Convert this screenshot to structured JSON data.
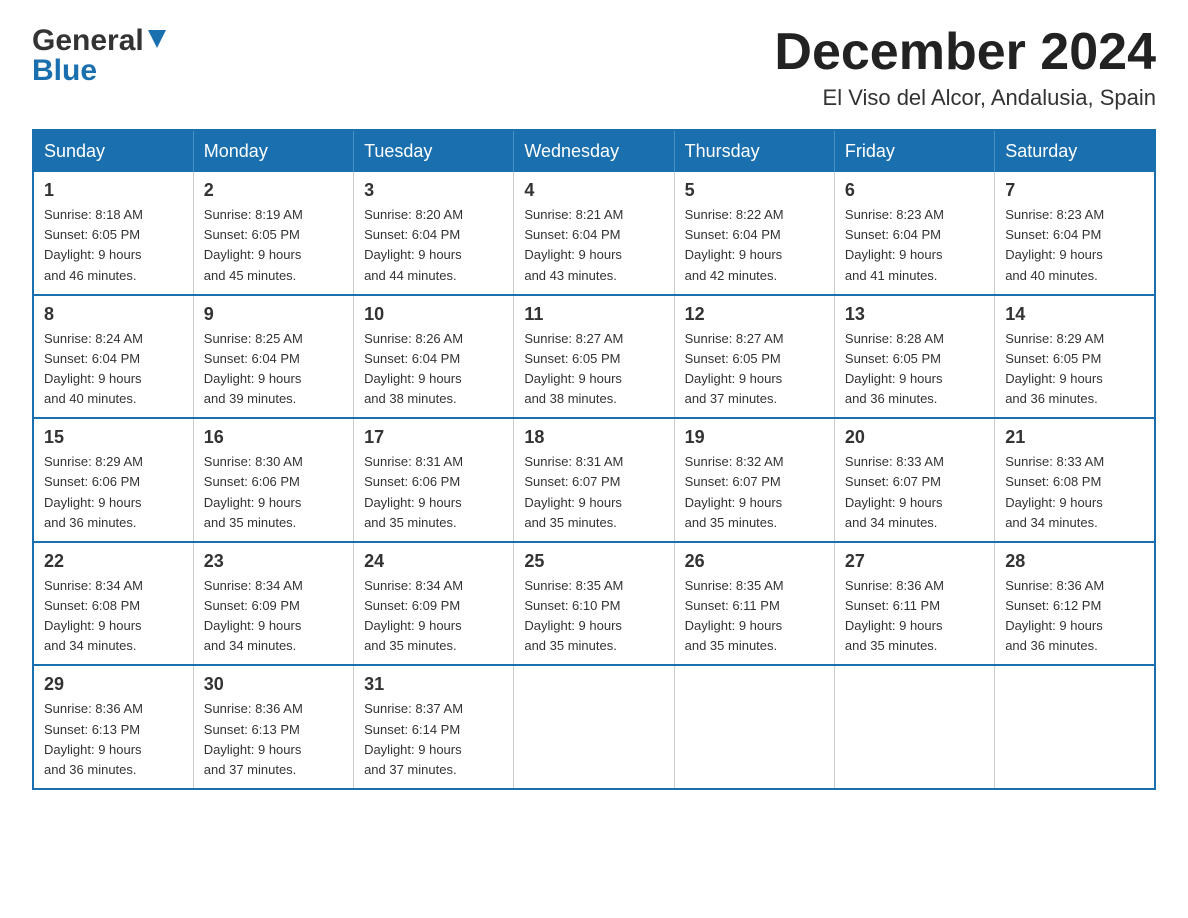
{
  "header": {
    "logo_general": "General",
    "logo_blue": "Blue",
    "month_title": "December 2024",
    "location": "El Viso del Alcor, Andalusia, Spain"
  },
  "days_of_week": [
    "Sunday",
    "Monday",
    "Tuesday",
    "Wednesday",
    "Thursday",
    "Friday",
    "Saturday"
  ],
  "weeks": [
    [
      {
        "day": "1",
        "sunrise": "8:18 AM",
        "sunset": "6:05 PM",
        "daylight": "9 hours and 46 minutes."
      },
      {
        "day": "2",
        "sunrise": "8:19 AM",
        "sunset": "6:05 PM",
        "daylight": "9 hours and 45 minutes."
      },
      {
        "day": "3",
        "sunrise": "8:20 AM",
        "sunset": "6:04 PM",
        "daylight": "9 hours and 44 minutes."
      },
      {
        "day": "4",
        "sunrise": "8:21 AM",
        "sunset": "6:04 PM",
        "daylight": "9 hours and 43 minutes."
      },
      {
        "day": "5",
        "sunrise": "8:22 AM",
        "sunset": "6:04 PM",
        "daylight": "9 hours and 42 minutes."
      },
      {
        "day": "6",
        "sunrise": "8:23 AM",
        "sunset": "6:04 PM",
        "daylight": "9 hours and 41 minutes."
      },
      {
        "day": "7",
        "sunrise": "8:23 AM",
        "sunset": "6:04 PM",
        "daylight": "9 hours and 40 minutes."
      }
    ],
    [
      {
        "day": "8",
        "sunrise": "8:24 AM",
        "sunset": "6:04 PM",
        "daylight": "9 hours and 40 minutes."
      },
      {
        "day": "9",
        "sunrise": "8:25 AM",
        "sunset": "6:04 PM",
        "daylight": "9 hours and 39 minutes."
      },
      {
        "day": "10",
        "sunrise": "8:26 AM",
        "sunset": "6:04 PM",
        "daylight": "9 hours and 38 minutes."
      },
      {
        "day": "11",
        "sunrise": "8:27 AM",
        "sunset": "6:05 PM",
        "daylight": "9 hours and 38 minutes."
      },
      {
        "day": "12",
        "sunrise": "8:27 AM",
        "sunset": "6:05 PM",
        "daylight": "9 hours and 37 minutes."
      },
      {
        "day": "13",
        "sunrise": "8:28 AM",
        "sunset": "6:05 PM",
        "daylight": "9 hours and 36 minutes."
      },
      {
        "day": "14",
        "sunrise": "8:29 AM",
        "sunset": "6:05 PM",
        "daylight": "9 hours and 36 minutes."
      }
    ],
    [
      {
        "day": "15",
        "sunrise": "8:29 AM",
        "sunset": "6:06 PM",
        "daylight": "9 hours and 36 minutes."
      },
      {
        "day": "16",
        "sunrise": "8:30 AM",
        "sunset": "6:06 PM",
        "daylight": "9 hours and 35 minutes."
      },
      {
        "day": "17",
        "sunrise": "8:31 AM",
        "sunset": "6:06 PM",
        "daylight": "9 hours and 35 minutes."
      },
      {
        "day": "18",
        "sunrise": "8:31 AM",
        "sunset": "6:07 PM",
        "daylight": "9 hours and 35 minutes."
      },
      {
        "day": "19",
        "sunrise": "8:32 AM",
        "sunset": "6:07 PM",
        "daylight": "9 hours and 35 minutes."
      },
      {
        "day": "20",
        "sunrise": "8:33 AM",
        "sunset": "6:07 PM",
        "daylight": "9 hours and 34 minutes."
      },
      {
        "day": "21",
        "sunrise": "8:33 AM",
        "sunset": "6:08 PM",
        "daylight": "9 hours and 34 minutes."
      }
    ],
    [
      {
        "day": "22",
        "sunrise": "8:34 AM",
        "sunset": "6:08 PM",
        "daylight": "9 hours and 34 minutes."
      },
      {
        "day": "23",
        "sunrise": "8:34 AM",
        "sunset": "6:09 PM",
        "daylight": "9 hours and 34 minutes."
      },
      {
        "day": "24",
        "sunrise": "8:34 AM",
        "sunset": "6:09 PM",
        "daylight": "9 hours and 35 minutes."
      },
      {
        "day": "25",
        "sunrise": "8:35 AM",
        "sunset": "6:10 PM",
        "daylight": "9 hours and 35 minutes."
      },
      {
        "day": "26",
        "sunrise": "8:35 AM",
        "sunset": "6:11 PM",
        "daylight": "9 hours and 35 minutes."
      },
      {
        "day": "27",
        "sunrise": "8:36 AM",
        "sunset": "6:11 PM",
        "daylight": "9 hours and 35 minutes."
      },
      {
        "day": "28",
        "sunrise": "8:36 AM",
        "sunset": "6:12 PM",
        "daylight": "9 hours and 36 minutes."
      }
    ],
    [
      {
        "day": "29",
        "sunrise": "8:36 AM",
        "sunset": "6:13 PM",
        "daylight": "9 hours and 36 minutes."
      },
      {
        "day": "30",
        "sunrise": "8:36 AM",
        "sunset": "6:13 PM",
        "daylight": "9 hours and 37 minutes."
      },
      {
        "day": "31",
        "sunrise": "8:37 AM",
        "sunset": "6:14 PM",
        "daylight": "9 hours and 37 minutes."
      },
      null,
      null,
      null,
      null
    ]
  ],
  "labels": {
    "sunrise": "Sunrise:",
    "sunset": "Sunset:",
    "daylight": "Daylight:"
  }
}
